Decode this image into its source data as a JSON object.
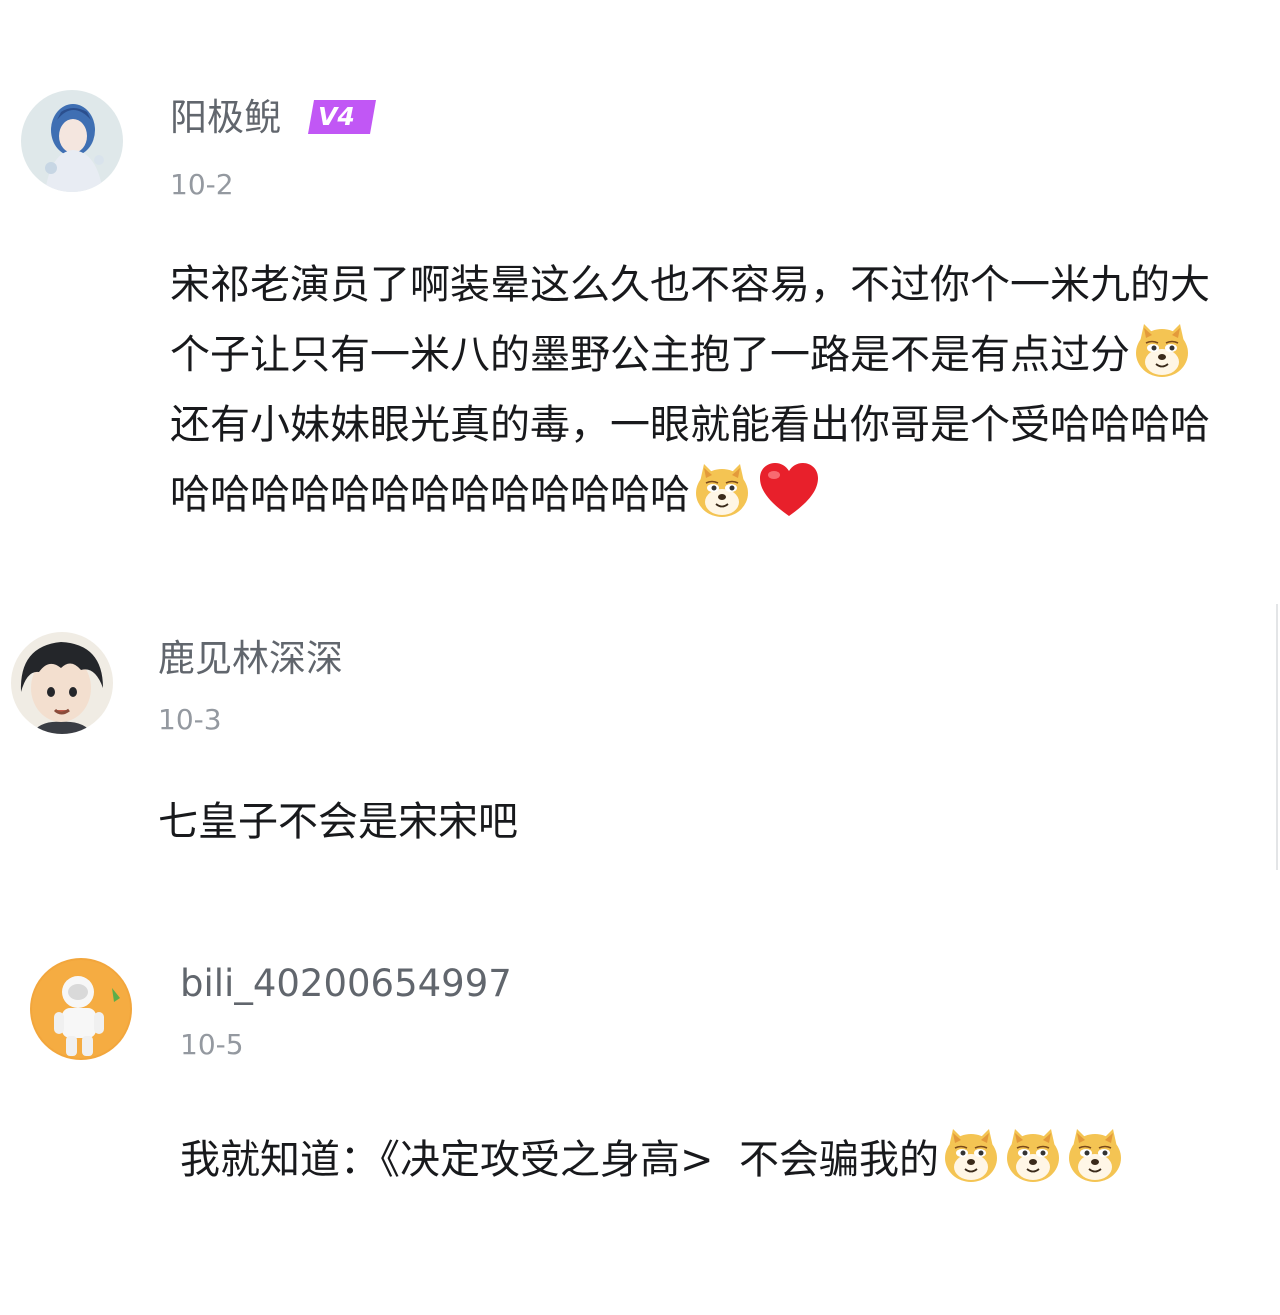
{
  "comments": [
    {
      "username": "阳极鲵",
      "level": "V4",
      "date": "10-2",
      "lines": [
        "宋祁老演员了啊装晕这么久也不容易，不过你个一米九的大个子让只有一米八的墨野公主抱了一路是不是有点过分",
        "还有小妹妹眼光真的毒，一眼就能看出你哥是个受哈哈哈哈哈哈哈哈哈哈哈哈哈哈哈哈哈"
      ],
      "emojis": [
        "doge-emoji",
        "doge-emoji",
        "heart-emoji"
      ]
    },
    {
      "username": "鹿见林深深",
      "date": "10-3",
      "text": "七皇子不会是宋宋吧"
    },
    {
      "username": "bili_40200654997",
      "date": "10-5",
      "text": "我就知道：《决定攻受之身高>  不会骗我的",
      "emojis": [
        "doge-emoji",
        "doge-emoji",
        "doge-emoji"
      ]
    }
  ],
  "colors": {
    "username": "#61666d",
    "date": "#9499a0",
    "text": "#18191c",
    "level_badge": "#c157f5",
    "heart": "#e8202b",
    "doge": "#f4c453"
  }
}
